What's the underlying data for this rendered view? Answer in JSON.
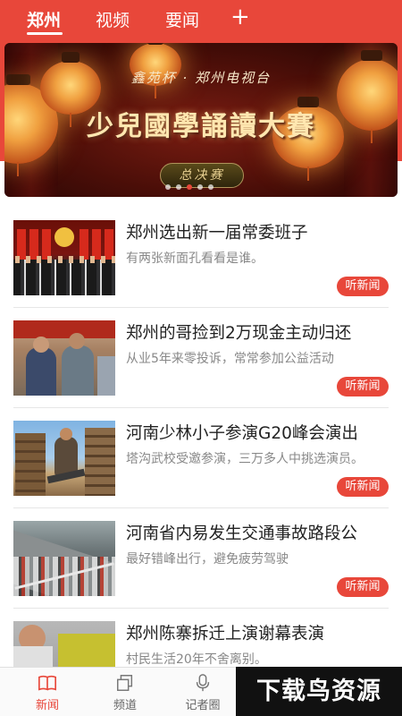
{
  "top_tabs": [
    {
      "label": "郑州",
      "active": true
    },
    {
      "label": "视频",
      "active": false
    },
    {
      "label": "要闻",
      "active": false
    }
  ],
  "add_tab_label": "+",
  "banner": {
    "subtitle": "鑫苑杯 · 郑州电视台",
    "title": "少兒國學誦讀大賽",
    "badge": "总决赛",
    "dot_count": 5,
    "active_dot": 3
  },
  "news": [
    {
      "title": "郑州选出新一届常委班子",
      "subtitle": "有两张新面孔看看是谁。",
      "listen_label": "听新闻"
    },
    {
      "title": "郑州的哥捡到2万现金主动归还",
      "subtitle": "从业5年来零投诉，常常参加公益活动",
      "listen_label": "听新闻"
    },
    {
      "title": "河南少林小子参演G20峰会演出",
      "subtitle": "塔沟武校受邀参演，三万多人中挑选演员。",
      "listen_label": "听新闻"
    },
    {
      "title": "河南省内易发生交通事故路段公",
      "subtitle": "最好错峰出行，避免疲劳驾驶",
      "listen_label": "听新闻"
    },
    {
      "title": "郑州陈寨拆迁上演谢幕表演",
      "subtitle": "村民生活20年不舍离别。",
      "listen_label": "听新闻"
    }
  ],
  "bottom_nav": [
    {
      "label": "新闻",
      "icon": "book-icon",
      "active": true
    },
    {
      "label": "频道",
      "icon": "layers-icon",
      "active": false
    },
    {
      "label": "记者圈",
      "icon": "microphone-icon",
      "active": false
    }
  ],
  "watermark": "下载鸟资源",
  "colors": {
    "accent": "#e8473a",
    "text": "#222222",
    "muted": "#888888"
  }
}
